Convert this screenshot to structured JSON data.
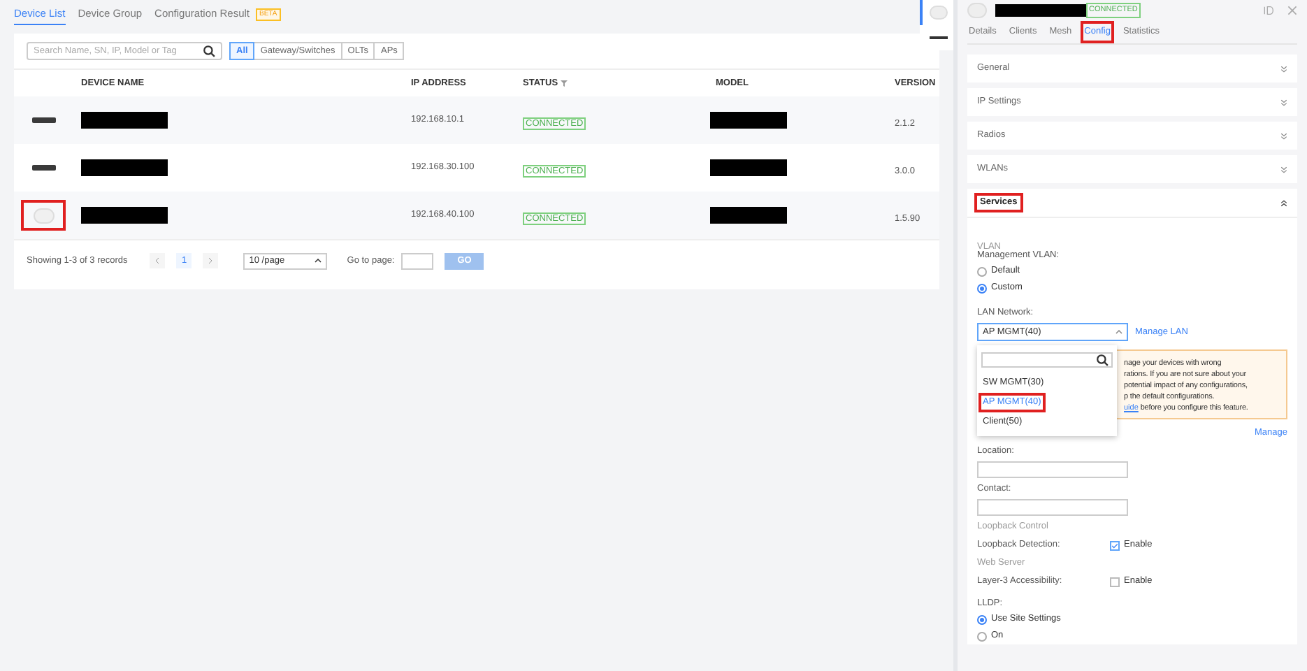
{
  "top_tabs": [
    {
      "label": "Device List",
      "selected": true
    },
    {
      "label": "Device Group",
      "selected": false
    },
    {
      "label": "Configuration Result",
      "selected": false,
      "badge": "BETA"
    }
  ],
  "search": {
    "placeholder": "Search Name, SN, IP, Model or Tag"
  },
  "filters": [
    {
      "label": "All",
      "selected": true
    },
    {
      "label": "Gateway/Switches",
      "selected": false
    },
    {
      "label": "OLTs",
      "selected": false
    },
    {
      "label": "APs",
      "selected": false
    }
  ],
  "table": {
    "columns": [
      "DEVICE NAME",
      "IP ADDRESS",
      "STATUS",
      "MODEL",
      "VERSION"
    ],
    "rows": [
      {
        "kind": "switch",
        "highlighted": false,
        "ip_address": "192.168.10.1",
        "status": "CONNECTED",
        "version": "2.1.2"
      },
      {
        "kind": "switch",
        "highlighted": false,
        "ip_address": "192.168.30.100",
        "status": "CONNECTED",
        "version": "3.0.0"
      },
      {
        "kind": "ap",
        "highlighted": true,
        "ip_address": "192.168.40.100",
        "status": "CONNECTED",
        "version": "1.5.90"
      }
    ]
  },
  "pagination": {
    "summary": "Showing 1-3 of 3 records",
    "pages": [
      {
        "label": "1",
        "selected": true
      }
    ],
    "page_size": "10 /page",
    "goto_label": "Go to page:",
    "go_button": "GO"
  },
  "side_thumbs": [
    {
      "kind": "ap",
      "selected": true
    },
    {
      "kind": "switch",
      "selected": false
    }
  ],
  "detail": {
    "status": "CONNECTED",
    "tabs": [
      {
        "label": "Details",
        "selected": false,
        "highlighted": false
      },
      {
        "label": "Clients",
        "selected": false,
        "highlighted": false
      },
      {
        "label": "Mesh",
        "selected": false,
        "highlighted": false
      },
      {
        "label": "Config",
        "selected": true,
        "highlighted": true
      },
      {
        "label": "Statistics",
        "selected": false,
        "highlighted": false
      }
    ],
    "sections": [
      {
        "title": "General",
        "expanded": false,
        "highlighted": false
      },
      {
        "title": "IP Settings",
        "expanded": false,
        "highlighted": false
      },
      {
        "title": "Radios",
        "expanded": false,
        "highlighted": false
      },
      {
        "title": "WLANs",
        "expanded": false,
        "highlighted": false
      },
      {
        "title": "Services",
        "expanded": true,
        "highlighted": true
      }
    ],
    "services": {
      "vlan_heading": "VLAN",
      "management_vlan_label": "Management VLAN:",
      "management_vlan_options": [
        {
          "label": "Default",
          "selected": false
        },
        {
          "label": "Custom",
          "selected": true
        }
      ],
      "lan_network_label": "LAN Network:",
      "lan_network_value": "AP MGMT(40)",
      "manage_lan_link": "Manage LAN",
      "dropdown": {
        "options": [
          {
            "label": "SW MGMT(30)",
            "selected": false,
            "highlighted": false
          },
          {
            "label": "AP MGMT(40)",
            "selected": true,
            "highlighted": true
          },
          {
            "label": "Client(50)",
            "selected": false,
            "highlighted": false
          }
        ]
      },
      "warning_lines": [
        "nage your devices with wrong",
        "rations. If you are not sure about your",
        "potential impact of any configurations,",
        "p the default configurations."
      ],
      "warning_link": "uide",
      "warning_tail": " before you configure this feature.",
      "manage_link": "Manage",
      "location_label": "Location:",
      "contact_label": "Contact:",
      "loopback_heading": "Loopback Control",
      "loopback_label": "Loopback Detection:",
      "loopback_checkbox": {
        "label": "Enable",
        "checked": true
      },
      "web_server_heading": "Web Server",
      "layer3_label": "Layer-3 Accessibility:",
      "layer3_checkbox": {
        "label": "Enable",
        "checked": false
      },
      "lldp_label": "LLDP:",
      "lldp_options": [
        {
          "label": "Use Site Settings",
          "selected": true
        },
        {
          "label": "On",
          "selected": false
        }
      ]
    }
  }
}
